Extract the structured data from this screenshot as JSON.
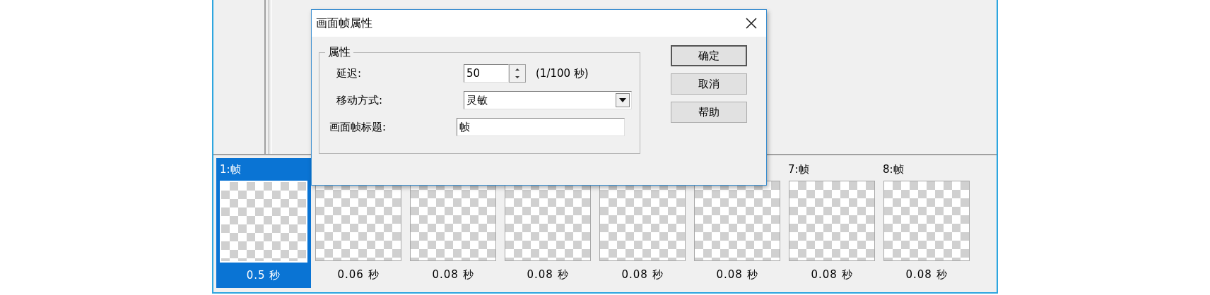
{
  "dialog": {
    "title": "画面帧属性",
    "group_title": "属性",
    "fields": [
      {
        "kind": "spin",
        "label": "延迟:",
        "value": "50",
        "suffix": "(1/100 秒)"
      },
      {
        "kind": "dropdown",
        "label": "移动方式:",
        "value": "灵敏"
      },
      {
        "kind": "text",
        "label": "画面帧标题:",
        "value": "帧"
      }
    ],
    "buttons": [
      {
        "label": "确定",
        "default": true
      },
      {
        "label": "取消",
        "default": false
      },
      {
        "label": "帮助",
        "default": false
      }
    ]
  },
  "frames": [
    {
      "label": "1:帧",
      "duration": "0.5 秒",
      "selected": true
    },
    {
      "duration": "0.06 秒",
      "selected": false
    },
    {
      "duration": "0.08 秒",
      "selected": false
    },
    {
      "duration": "0.08 秒",
      "selected": false
    },
    {
      "duration": "0.08 秒",
      "selected": false
    },
    {
      "duration": "0.08 秒",
      "selected": false
    },
    {
      "label": "7:帧",
      "duration": "0.08 秒",
      "selected": false
    },
    {
      "label": "8:帧",
      "duration": "0.08 秒",
      "selected": false
    }
  ]
}
